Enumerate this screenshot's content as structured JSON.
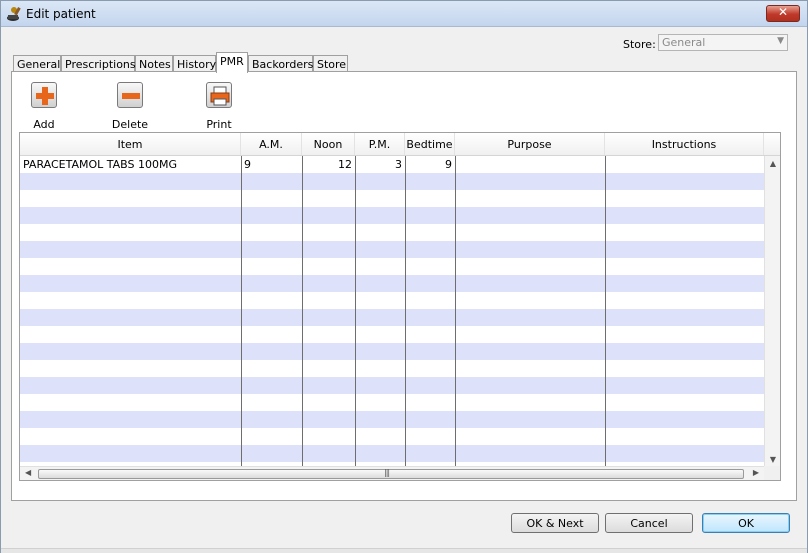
{
  "window": {
    "title": "Edit patient",
    "close_glyph": "✕"
  },
  "store": {
    "label": "Store:",
    "value": "General"
  },
  "tabs": [
    {
      "label": "General"
    },
    {
      "label": "Prescriptions"
    },
    {
      "label": "Notes"
    },
    {
      "label": "History"
    },
    {
      "label": "PMR",
      "active": true
    },
    {
      "label": "Backorders"
    },
    {
      "label": "Store"
    }
  ],
  "toolbar": {
    "add_label": "Add",
    "delete_label": "Delete",
    "print_label": "Print"
  },
  "grid": {
    "columns": [
      "Item",
      "A.M.",
      "Noon",
      "P.M.",
      "Bedtime",
      "Purpose",
      "Instructions"
    ],
    "rows": [
      {
        "item": "PARACETAMOL TABS 100MG",
        "am": "9",
        "noon": "12",
        "pm": "3",
        "bedtime": "9",
        "purpose": "",
        "instructions": ""
      }
    ],
    "scroll_grip": "|||"
  },
  "buttons": {
    "ok_next": "OK & Next",
    "cancel": "Cancel",
    "ok": "OK"
  },
  "colors": {
    "stripe": "#dde2fa",
    "default_button": "#bee6fd",
    "close_button": "#c0392b"
  }
}
